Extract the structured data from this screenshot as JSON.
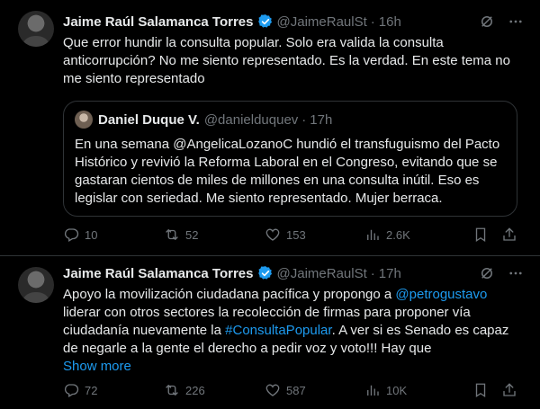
{
  "tweets": [
    {
      "author": {
        "name": "Jaime Raúl Salamanca Torres",
        "handle": "@JaimeRaulSt",
        "time": "16h"
      },
      "text": "Que error hundir la consulta popular. Solo era valida la consulta anticorrupción? No me siento representado. Es la verdad. En este tema no me siento representado",
      "quote": {
        "author": {
          "name": "Daniel Duque V.",
          "handle": "@danielduquev",
          "time": "17h"
        },
        "text": "En una semana @AngelicaLozanoC hundió el transfuguismo del Pacto Histórico y revivió la Reforma Laboral en el Congreso, evitando que se gastaran cientos de miles de millones en una consulta inútil. Eso es legislar con seriedad. Me siento representado. Mujer berraca."
      },
      "stats": {
        "replies": "10",
        "reposts": "52",
        "likes": "153",
        "views": "2.6K"
      }
    },
    {
      "author": {
        "name": "Jaime Raúl Salamanca Torres",
        "handle": "@JaimeRaulSt",
        "time": "17h"
      },
      "text_part1": "Apoyo la movilización ciudadana pacífica y propongo a ",
      "mention": "@petrogustavo",
      "text_part2": " liderar con otros sectores la recolección de firmas para proponer vía ciudadanía nuevamente la ",
      "hashtag": "#ConsultaPopular",
      "text_part3": ". A ver si es Senado es capaz de negarle a la gente el derecho a pedir voz y voto!!! Hay que",
      "show_more": "Show more",
      "stats": {
        "replies": "72",
        "reposts": "226",
        "likes": "587",
        "views": "10K"
      }
    }
  ],
  "colors": {
    "background": "#000000",
    "text": "#e7e9ea",
    "muted": "#71767b",
    "link": "#1d9bf0",
    "border": "#2f3336",
    "verified": "#1d9bf0"
  }
}
